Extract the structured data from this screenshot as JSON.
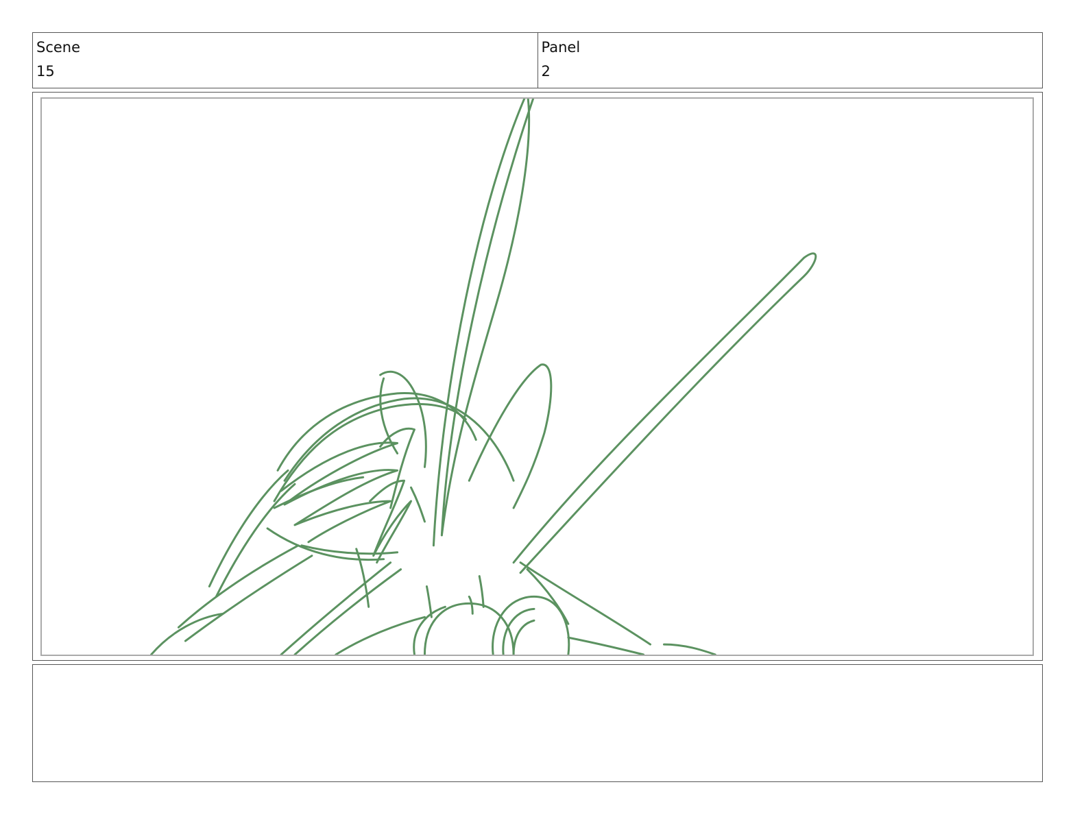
{
  "header": {
    "scene_label": "Scene",
    "scene_value": "15",
    "panel_label": "Panel",
    "panel_value": "2"
  },
  "sketch": {
    "stroke_color": "#3f7f45"
  },
  "notes": {
    "text": ""
  }
}
